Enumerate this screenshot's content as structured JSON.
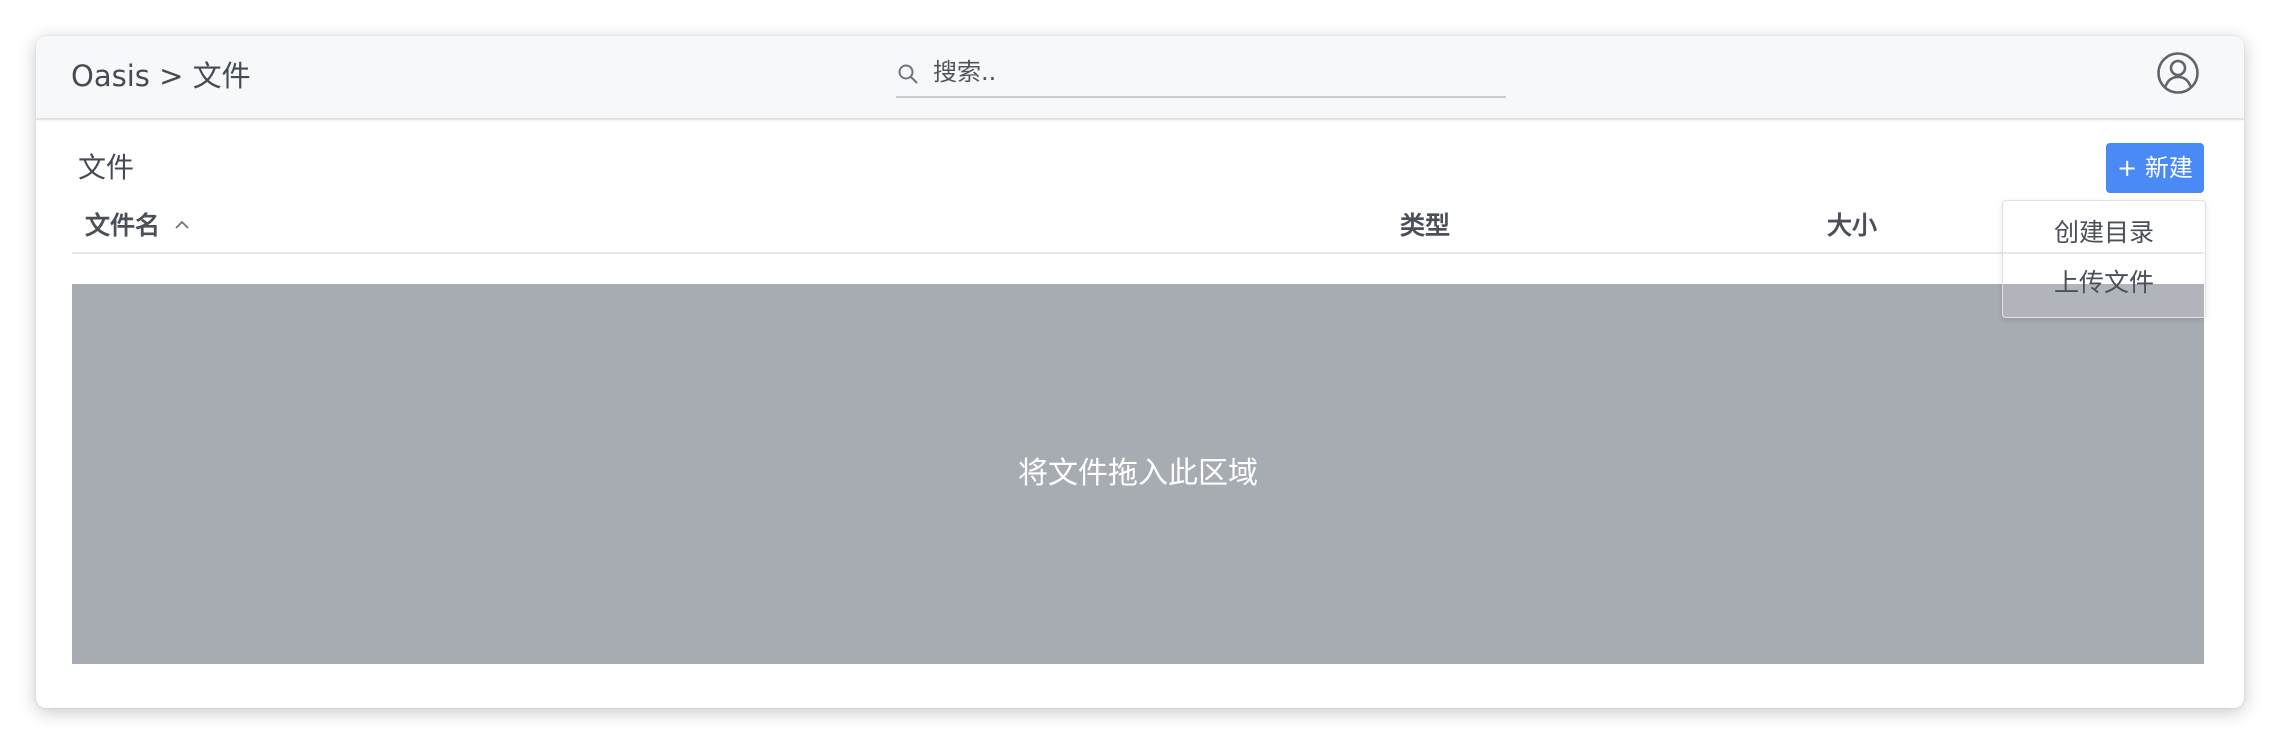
{
  "header": {
    "breadcrumb": "Oasis > 文件",
    "search": {
      "placeholder": "搜索..",
      "value": "",
      "icon": "search-icon"
    },
    "avatar_icon": "user-circle-icon"
  },
  "main": {
    "section_title": "文件",
    "new_button_label": "+ 新建",
    "new_menu": {
      "items": [
        "创建目录",
        "上传文件"
      ]
    },
    "table": {
      "columns": [
        "文件名",
        "类型",
        "大小"
      ],
      "sort_icon": "chevron-up-icon"
    },
    "dropzone_text": "将文件拖入此区域"
  },
  "colors": {
    "accent": "#4a8af4",
    "dropzone": "#a7abb2",
    "topbar": "#f7f8fa"
  }
}
